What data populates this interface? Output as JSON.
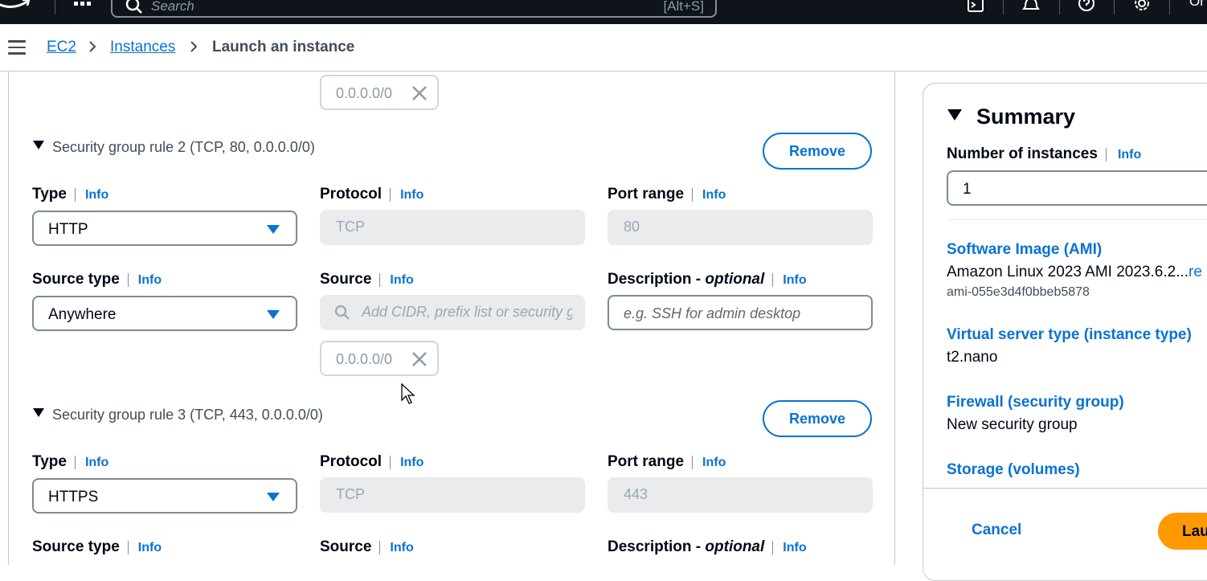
{
  "topbar": {
    "search_placeholder": "Search",
    "search_shortcut": "[Alt+S]",
    "user_label": "Or"
  },
  "breadcrumb": {
    "items": [
      "EC2",
      "Instances",
      "Launch an instance"
    ]
  },
  "form": {
    "top_token": "0.0.0.0/0",
    "rules": [
      {
        "heading": "Security group rule 2 (TCP, 80, 0.0.0.0/0)",
        "remove_label": "Remove",
        "type_label": "Type",
        "type_value": "HTTP",
        "protocol_label": "Protocol",
        "protocol_value": "TCP",
        "port_label": "Port range",
        "port_value": "80",
        "source_type_label": "Source type",
        "source_type_value": "Anywhere",
        "source_label": "Source",
        "source_placeholder": "Add CIDR, prefix list or security group",
        "source_token": "0.0.0.0/0",
        "description_label": "Description - ",
        "description_optional": "optional",
        "description_placeholder": "e.g. SSH for admin desktop"
      },
      {
        "heading": "Security group rule 3 (TCP, 443, 0.0.0.0/0)",
        "remove_label": "Remove",
        "type_label": "Type",
        "type_value": "HTTPS",
        "protocol_label": "Protocol",
        "protocol_value": "TCP",
        "port_label": "Port range",
        "port_value": "443",
        "source_type_label": "Source type",
        "source_label": "Source",
        "description_label": "Description - ",
        "description_optional": "optional"
      }
    ],
    "info_label": "Info"
  },
  "summary": {
    "title": "Summary",
    "instances_label": "Number of instances",
    "info_label": "Info",
    "instances_value": "1",
    "ami_label": "Software Image (AMI)",
    "ami_value": "Amazon Linux 2023 AMI 2023.6.2...",
    "ami_more": "re",
    "ami_id": "ami-055e3d4f0bbeb5878",
    "instance_type_label": "Virtual server type (instance type)",
    "instance_type_value": "t2.nano",
    "firewall_label": "Firewall (security group)",
    "firewall_value": "New security group",
    "storage_label": "Storage (volumes)",
    "cancel_label": "Cancel",
    "launch_label": "Lau"
  }
}
